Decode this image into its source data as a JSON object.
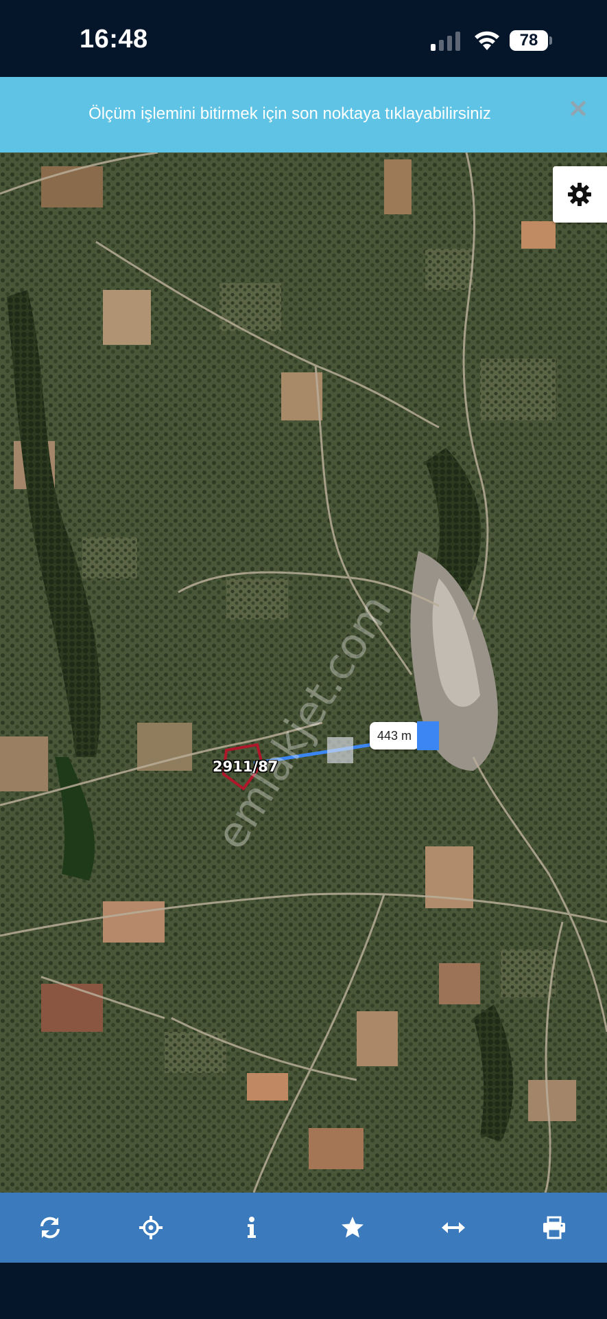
{
  "status_bar": {
    "time": "16:48",
    "battery": "78",
    "icons": [
      "signal-icon",
      "wifi-icon",
      "battery-icon"
    ]
  },
  "banner": {
    "message": "Ölçüm işlemini bitirmek için son noktaya tıklayabilirsiniz",
    "close_icon": "close-icon",
    "close_glyph": "✕"
  },
  "map": {
    "type": "satellite",
    "measurement": {
      "distance_label": "443 m"
    },
    "parcel": {
      "label": "2911/87"
    },
    "watermark": "emlakjet.com",
    "settings_icon": "gear-icon"
  },
  "toolbar": {
    "items": [
      {
        "name": "refresh",
        "icon": "refresh-icon"
      },
      {
        "name": "locate",
        "icon": "crosshair-icon"
      },
      {
        "name": "info",
        "icon": "info-icon"
      },
      {
        "name": "favorite",
        "icon": "star-icon"
      },
      {
        "name": "measure",
        "icon": "horizontal-arrows-icon"
      },
      {
        "name": "print",
        "icon": "printer-icon"
      }
    ]
  },
  "colors": {
    "banner": "#5ec3e4",
    "toolbar": "#3a7abd",
    "status_bar": "#05162b",
    "measure_line": "#3b86f2",
    "parcel_outline": "#b0172a"
  }
}
